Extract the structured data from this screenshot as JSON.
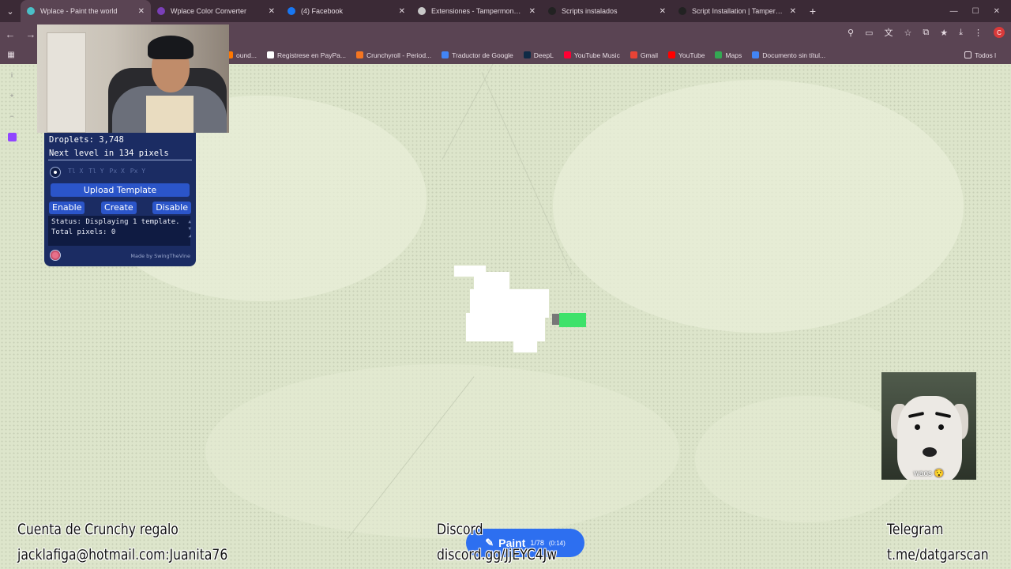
{
  "tabs": [
    {
      "title": "Wplace - Paint the world",
      "favicon_color": "#4ac0c8",
      "active": true
    },
    {
      "title": "Wplace Color Converter",
      "favicon_color": "#7a3fb8",
      "active": false
    },
    {
      "title": "(4) Facebook",
      "favicon_color": "#1877f2",
      "active": false
    },
    {
      "title": "Extensiones - Tampermonkey",
      "favicon_color": "#c8c8c8",
      "active": false
    },
    {
      "title": "Scripts instalados",
      "favicon_color": "#222222",
      "active": false
    },
    {
      "title": "Script Installation | Tampermo",
      "favicon_color": "#222222",
      "active": false
    }
  ],
  "toolbar": {
    "profile_initial": "C"
  },
  "bookmarks": [
    {
      "label": "ound...",
      "color": "#ff7700"
    },
    {
      "label": "Registrese en PayPa...",
      "color": "#ffffff"
    },
    {
      "label": "Crunchyroll - Period...",
      "color": "#f47521"
    },
    {
      "label": "Traductor de Google",
      "color": "#4285f4"
    },
    {
      "label": "DeepL",
      "color": "#0f2b46"
    },
    {
      "label": "YouTube Music",
      "color": "#ff0033"
    },
    {
      "label": "Gmail",
      "color": "#ea4335"
    },
    {
      "label": "YouTube",
      "color": "#ff0000"
    },
    {
      "label": "Maps",
      "color": "#34a853"
    },
    {
      "label": "Documento sin títul...",
      "color": "#4285f4"
    }
  ],
  "bookmarks_all": "Todos l",
  "panel": {
    "droplets": "Droplets: 3,748",
    "next_level": "Next level in 134 pixels",
    "coord_placeholders": [
      "Tl X",
      "Tl Y",
      "Px X",
      "Px Y"
    ],
    "upload": "Upload Template",
    "enable": "Enable",
    "create": "Create",
    "disable": "Disable",
    "status": "Status: Displaying 1 template.\nTotal pixels: 0",
    "made_by": "Made by SwingTheVine"
  },
  "paint_button": {
    "label": "Paint",
    "count": "1/78",
    "time": "(0:14)"
  },
  "dog_caption": "waos 😯",
  "overlay": {
    "crunchy_title": "Cuenta de Crunchy regalo",
    "crunchy_login": "jacklafiga@hotmail.com:Juanita76",
    "discord_title": "Discord",
    "discord_link": "discord.gg/JjEYC4Jw",
    "telegram_title": "Telegram",
    "telegram_link": "t.me/datgarscan"
  },
  "colors": {
    "accent_blue": "#2d6ff0",
    "panel_bg": "#1b2c63",
    "map_bg": "#dde5cb",
    "selected_green": "#3ee26a"
  }
}
